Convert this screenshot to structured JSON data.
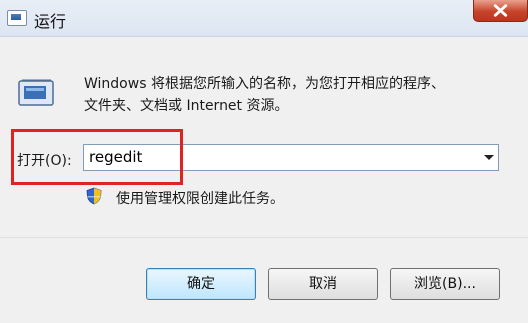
{
  "window": {
    "title": "运行",
    "icon": "run-icon",
    "close_icon": "close-icon"
  },
  "description": {
    "line1": "Windows 将根据您所输入的名称，为您打开相应的程序、",
    "line2": "文件夹、文档或 Internet 资源。"
  },
  "open_field": {
    "label": "打开(O):",
    "value": "regedit"
  },
  "admin_note": {
    "icon": "uac-shield-icon",
    "text": "使用管理权限创建此任务。"
  },
  "buttons": {
    "ok": "确定",
    "cancel": "取消",
    "browse": "浏览(B)..."
  },
  "colors": {
    "highlight": "#e02222",
    "close_button": "#c7442a"
  }
}
